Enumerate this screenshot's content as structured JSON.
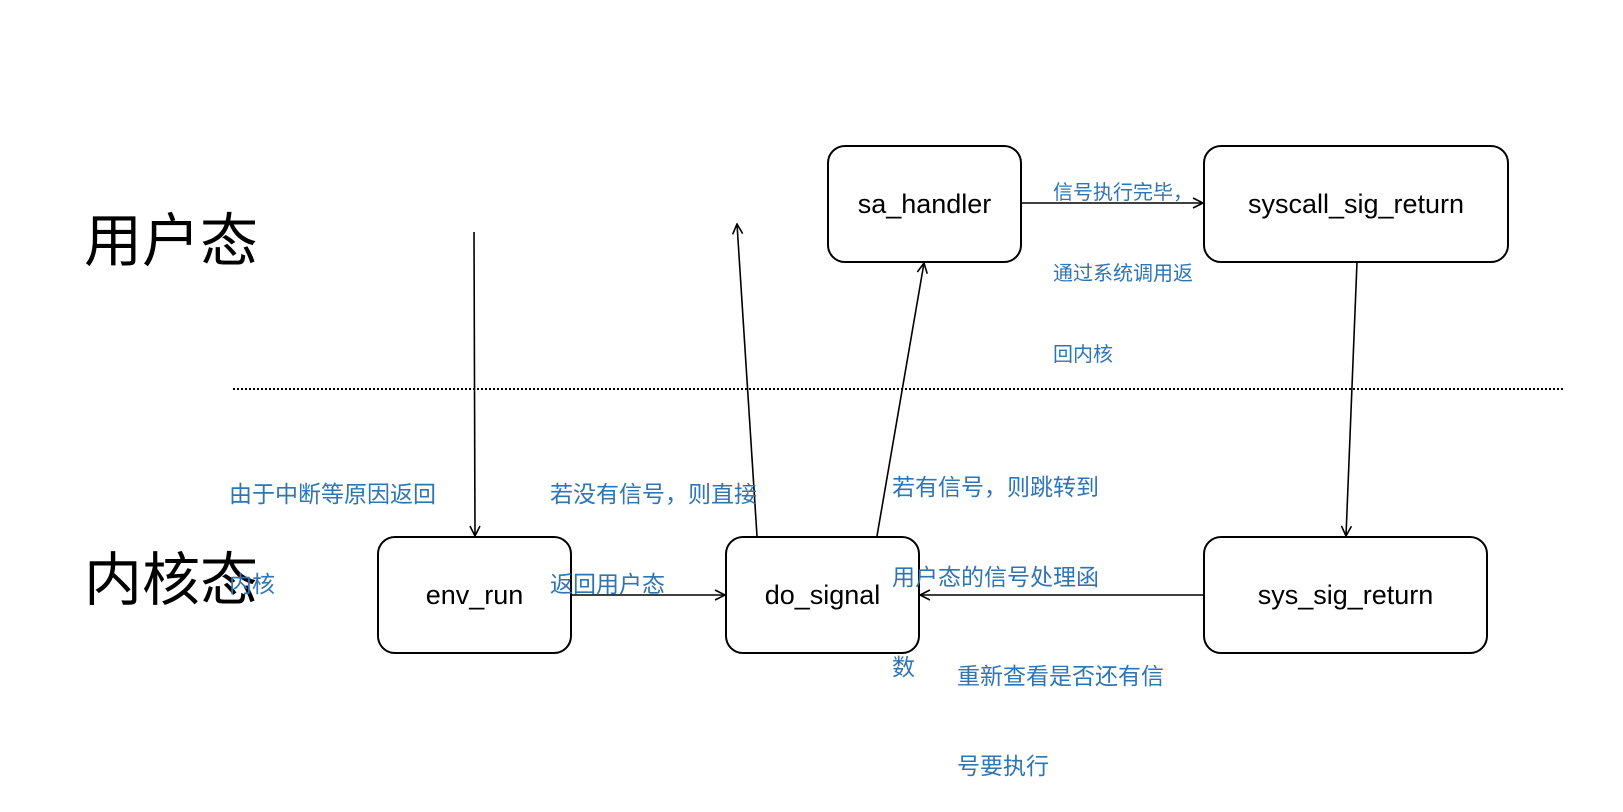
{
  "regions": {
    "user_mode": "用户态",
    "kernel_mode": "内核态"
  },
  "nodes": {
    "sa_handler": "sa_handler",
    "syscall_sig_return": "syscall_sig_return",
    "env_run": "env_run",
    "do_signal": "do_signal",
    "sys_sig_return": "sys_sig_return"
  },
  "annotations": {
    "interrupt_return": [
      "由于中断等原因返回",
      "内核"
    ],
    "no_signal": [
      "若没有信号，则直接",
      "返回用户态"
    ],
    "has_signal": [
      "若有信号，则跳转到",
      "用户态的信号处理函",
      "数"
    ],
    "handler_done": [
      "信号执行完毕，",
      "通过系统调用返",
      "回内核"
    ],
    "recheck": [
      "重新查看是否还有信",
      "号要执行"
    ]
  },
  "colors": {
    "annotation_text": "#2e75b6",
    "lines": "#000000",
    "background": "#ffffff"
  }
}
